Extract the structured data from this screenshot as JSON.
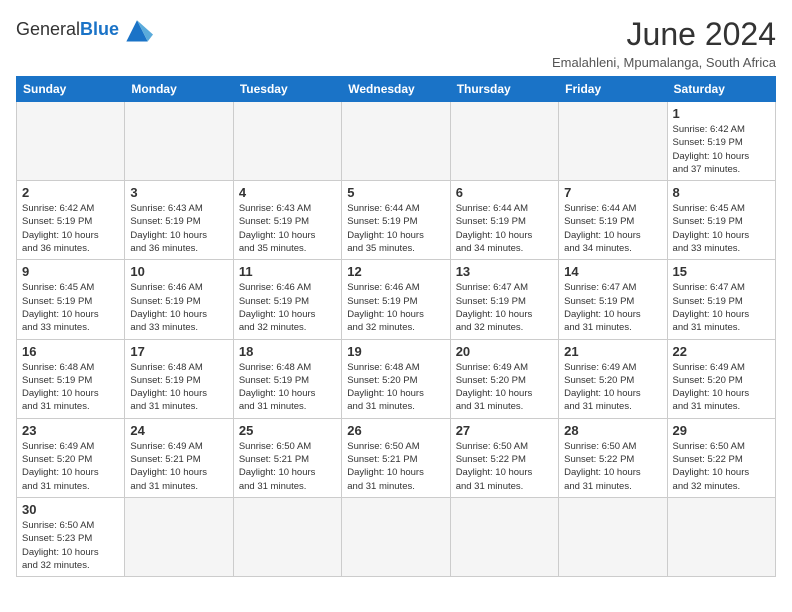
{
  "logo": {
    "text_general": "General",
    "text_blue": "Blue"
  },
  "header": {
    "title": "June 2024",
    "subtitle": "Emalahleni, Mpumalanga, South Africa"
  },
  "weekdays": [
    "Sunday",
    "Monday",
    "Tuesday",
    "Wednesday",
    "Thursday",
    "Friday",
    "Saturday"
  ],
  "weeks": [
    [
      {
        "day": "",
        "info": ""
      },
      {
        "day": "",
        "info": ""
      },
      {
        "day": "",
        "info": ""
      },
      {
        "day": "",
        "info": ""
      },
      {
        "day": "",
        "info": ""
      },
      {
        "day": "",
        "info": ""
      },
      {
        "day": "1",
        "info": "Sunrise: 6:42 AM\nSunset: 5:19 PM\nDaylight: 10 hours\nand 37 minutes."
      }
    ],
    [
      {
        "day": "2",
        "info": "Sunrise: 6:42 AM\nSunset: 5:19 PM\nDaylight: 10 hours\nand 36 minutes."
      },
      {
        "day": "3",
        "info": "Sunrise: 6:43 AM\nSunset: 5:19 PM\nDaylight: 10 hours\nand 36 minutes."
      },
      {
        "day": "4",
        "info": "Sunrise: 6:43 AM\nSunset: 5:19 PM\nDaylight: 10 hours\nand 35 minutes."
      },
      {
        "day": "5",
        "info": "Sunrise: 6:44 AM\nSunset: 5:19 PM\nDaylight: 10 hours\nand 35 minutes."
      },
      {
        "day": "6",
        "info": "Sunrise: 6:44 AM\nSunset: 5:19 PM\nDaylight: 10 hours\nand 34 minutes."
      },
      {
        "day": "7",
        "info": "Sunrise: 6:44 AM\nSunset: 5:19 PM\nDaylight: 10 hours\nand 34 minutes."
      },
      {
        "day": "8",
        "info": "Sunrise: 6:45 AM\nSunset: 5:19 PM\nDaylight: 10 hours\nand 33 minutes."
      }
    ],
    [
      {
        "day": "9",
        "info": "Sunrise: 6:45 AM\nSunset: 5:19 PM\nDaylight: 10 hours\nand 33 minutes."
      },
      {
        "day": "10",
        "info": "Sunrise: 6:46 AM\nSunset: 5:19 PM\nDaylight: 10 hours\nand 33 minutes."
      },
      {
        "day": "11",
        "info": "Sunrise: 6:46 AM\nSunset: 5:19 PM\nDaylight: 10 hours\nand 32 minutes."
      },
      {
        "day": "12",
        "info": "Sunrise: 6:46 AM\nSunset: 5:19 PM\nDaylight: 10 hours\nand 32 minutes."
      },
      {
        "day": "13",
        "info": "Sunrise: 6:47 AM\nSunset: 5:19 PM\nDaylight: 10 hours\nand 32 minutes."
      },
      {
        "day": "14",
        "info": "Sunrise: 6:47 AM\nSunset: 5:19 PM\nDaylight: 10 hours\nand 31 minutes."
      },
      {
        "day": "15",
        "info": "Sunrise: 6:47 AM\nSunset: 5:19 PM\nDaylight: 10 hours\nand 31 minutes."
      }
    ],
    [
      {
        "day": "16",
        "info": "Sunrise: 6:48 AM\nSunset: 5:19 PM\nDaylight: 10 hours\nand 31 minutes."
      },
      {
        "day": "17",
        "info": "Sunrise: 6:48 AM\nSunset: 5:19 PM\nDaylight: 10 hours\nand 31 minutes."
      },
      {
        "day": "18",
        "info": "Sunrise: 6:48 AM\nSunset: 5:19 PM\nDaylight: 10 hours\nand 31 minutes."
      },
      {
        "day": "19",
        "info": "Sunrise: 6:48 AM\nSunset: 5:20 PM\nDaylight: 10 hours\nand 31 minutes."
      },
      {
        "day": "20",
        "info": "Sunrise: 6:49 AM\nSunset: 5:20 PM\nDaylight: 10 hours\nand 31 minutes."
      },
      {
        "day": "21",
        "info": "Sunrise: 6:49 AM\nSunset: 5:20 PM\nDaylight: 10 hours\nand 31 minutes."
      },
      {
        "day": "22",
        "info": "Sunrise: 6:49 AM\nSunset: 5:20 PM\nDaylight: 10 hours\nand 31 minutes."
      }
    ],
    [
      {
        "day": "23",
        "info": "Sunrise: 6:49 AM\nSunset: 5:20 PM\nDaylight: 10 hours\nand 31 minutes."
      },
      {
        "day": "24",
        "info": "Sunrise: 6:49 AM\nSunset: 5:21 PM\nDaylight: 10 hours\nand 31 minutes."
      },
      {
        "day": "25",
        "info": "Sunrise: 6:50 AM\nSunset: 5:21 PM\nDaylight: 10 hours\nand 31 minutes."
      },
      {
        "day": "26",
        "info": "Sunrise: 6:50 AM\nSunset: 5:21 PM\nDaylight: 10 hours\nand 31 minutes."
      },
      {
        "day": "27",
        "info": "Sunrise: 6:50 AM\nSunset: 5:22 PM\nDaylight: 10 hours\nand 31 minutes."
      },
      {
        "day": "28",
        "info": "Sunrise: 6:50 AM\nSunset: 5:22 PM\nDaylight: 10 hours\nand 31 minutes."
      },
      {
        "day": "29",
        "info": "Sunrise: 6:50 AM\nSunset: 5:22 PM\nDaylight: 10 hours\nand 32 minutes."
      }
    ],
    [
      {
        "day": "30",
        "info": "Sunrise: 6:50 AM\nSunset: 5:23 PM\nDaylight: 10 hours\nand 32 minutes."
      },
      {
        "day": "",
        "info": ""
      },
      {
        "day": "",
        "info": ""
      },
      {
        "day": "",
        "info": ""
      },
      {
        "day": "",
        "info": ""
      },
      {
        "day": "",
        "info": ""
      },
      {
        "day": "",
        "info": ""
      }
    ]
  ]
}
